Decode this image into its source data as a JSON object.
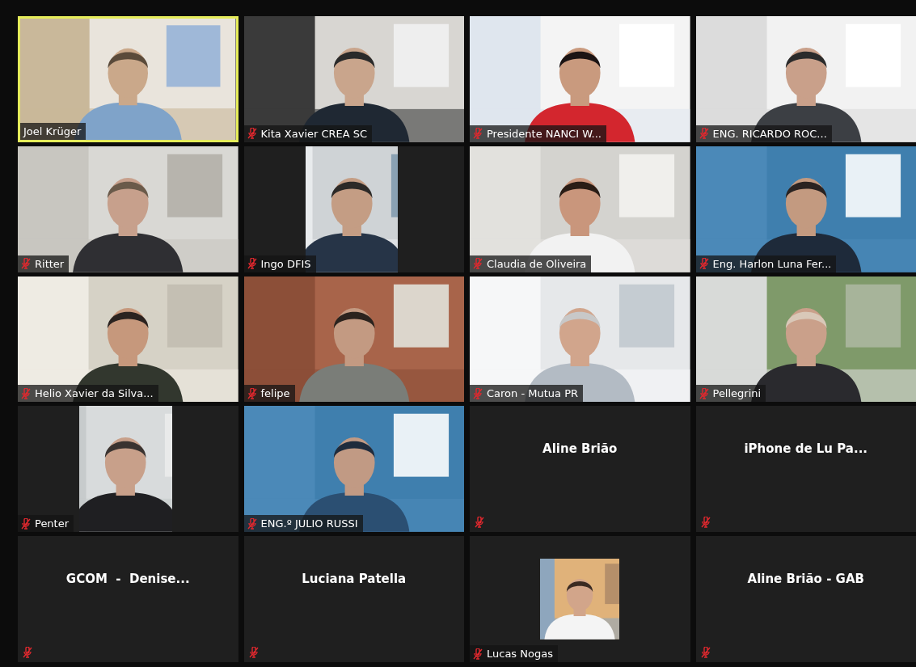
{
  "tiles": [
    {
      "name": "Joel Krüger",
      "kind": "video",
      "muted": false,
      "selected": true
    },
    {
      "name": "Kita Xavier CREA SC",
      "kind": "video",
      "muted": true,
      "selected": false
    },
    {
      "name": "Presidente NANCI W...",
      "kind": "video",
      "muted": true,
      "selected": false
    },
    {
      "name": "ENG. RICARDO ROC...",
      "kind": "video",
      "muted": true,
      "selected": false
    },
    {
      "name": "Ritter",
      "kind": "video",
      "muted": true,
      "selected": false
    },
    {
      "name": "Ingo DFIS",
      "kind": "inset",
      "muted": true,
      "selected": false
    },
    {
      "name": "Claudia de Oliveira",
      "kind": "video",
      "muted": true,
      "selected": false
    },
    {
      "name": "Eng. Harlon Luna Fer...",
      "kind": "video",
      "muted": true,
      "selected": false
    },
    {
      "name": "Helio Xavier da Silva...",
      "kind": "video",
      "muted": true,
      "selected": false
    },
    {
      "name": "felipe",
      "kind": "video",
      "muted": true,
      "selected": false
    },
    {
      "name": "Caron - Mutua PR",
      "kind": "video",
      "muted": true,
      "selected": false
    },
    {
      "name": "Pellegrini",
      "kind": "video",
      "muted": true,
      "selected": false
    },
    {
      "name": "Penter",
      "kind": "inset",
      "muted": true,
      "selected": false
    },
    {
      "name": "ENG.º JULIO RUSSI",
      "kind": "video",
      "muted": true,
      "selected": false
    },
    {
      "name": "Aline Brião",
      "kind": "name_only",
      "muted": true,
      "selected": false
    },
    {
      "name": "iPhone de Lu Pa...",
      "kind": "name_only",
      "muted": true,
      "selected": false
    },
    {
      "name": "GCOM  -  Denise...",
      "kind": "name_only",
      "muted": true,
      "selected": false
    },
    {
      "name": "Luciana Patella",
      "kind": "name_only",
      "muted": true,
      "selected": false
    },
    {
      "name": "Lucas Nogas",
      "kind": "avatar",
      "muted": true,
      "selected": false
    },
    {
      "name": "Aline Brião - GAB",
      "kind": "name_only",
      "muted": true,
      "selected": false
    }
  ]
}
